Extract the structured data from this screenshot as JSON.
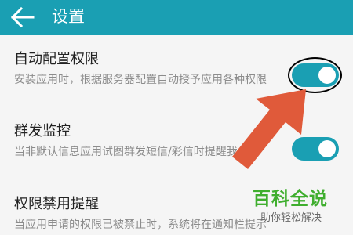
{
  "appbar": {
    "title": "设置",
    "back_icon": "arrow-left-icon",
    "background_color": "#1a9fb3"
  },
  "settings": [
    {
      "title": "自动配置权限",
      "description": "安装应用时，根据服务器配置自动授予应用各种权限",
      "toggle_on": true
    },
    {
      "title": "群发监控",
      "description": "当非默认信息应用试图群发短信/彩信时提醒我",
      "toggle_on": true
    },
    {
      "title": "权限禁用提醒",
      "description": "当应用申请的权限已被禁止时，系统将在通知栏提示",
      "toggle_on": true
    }
  ],
  "overlay": {
    "arrow_icon": "pointer-arrow-icon",
    "arrow_color": "#e05a3a",
    "highlight_color": "#000000"
  },
  "watermark": {
    "main_text": "百科全说",
    "sub_text": "助你轻松解决",
    "main_color": "#3fae2e"
  }
}
